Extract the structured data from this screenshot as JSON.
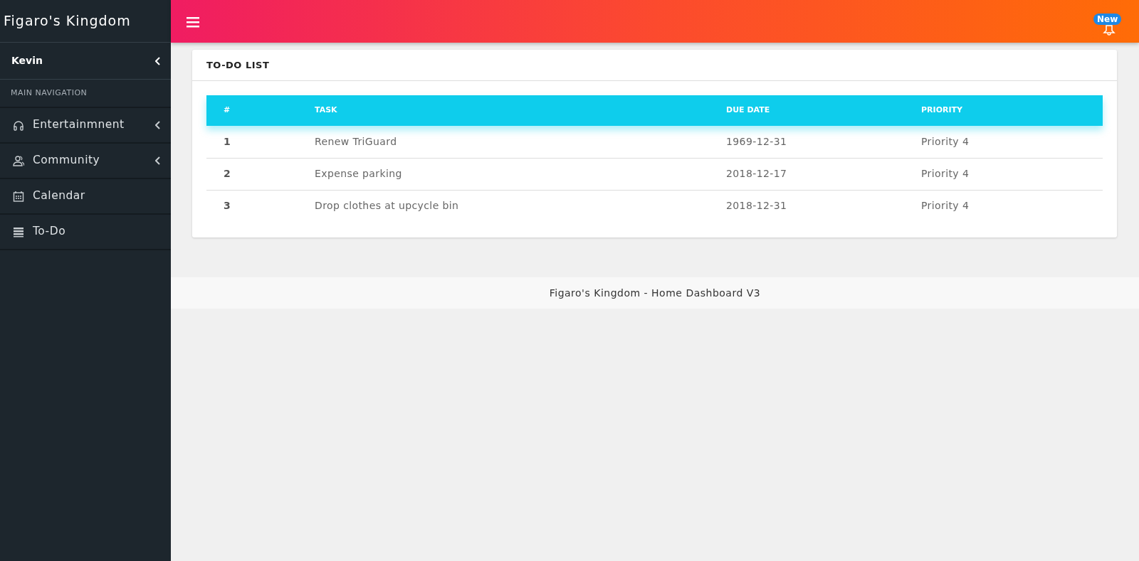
{
  "brand": "Figaro's Kingdom",
  "user": {
    "name": "Kevin"
  },
  "nav_header": "MAIN NAVIGATION",
  "nav_items": [
    {
      "label": "Entertainmnent",
      "expandable": true
    },
    {
      "label": "Community",
      "expandable": true
    },
    {
      "label": "Calendar",
      "expandable": false
    },
    {
      "label": "To-Do",
      "expandable": false
    }
  ],
  "notification_badge": "New",
  "card": {
    "title": "TO-DO LIST",
    "table": {
      "columns": [
        "#",
        "TASK",
        "DUE DATE",
        "PRIORITY"
      ],
      "rows": [
        [
          "1",
          "Renew TriGuard",
          "1969-12-31",
          "Priority 4"
        ],
        [
          "2",
          "Expense parking",
          "2018-12-17",
          "Priority 4"
        ],
        [
          "3",
          "Drop clothes at upcycle bin",
          "2018-12-31",
          "Priority 4"
        ]
      ]
    }
  },
  "footer": "Figaro's Kingdom - Home Dashboard V3"
}
